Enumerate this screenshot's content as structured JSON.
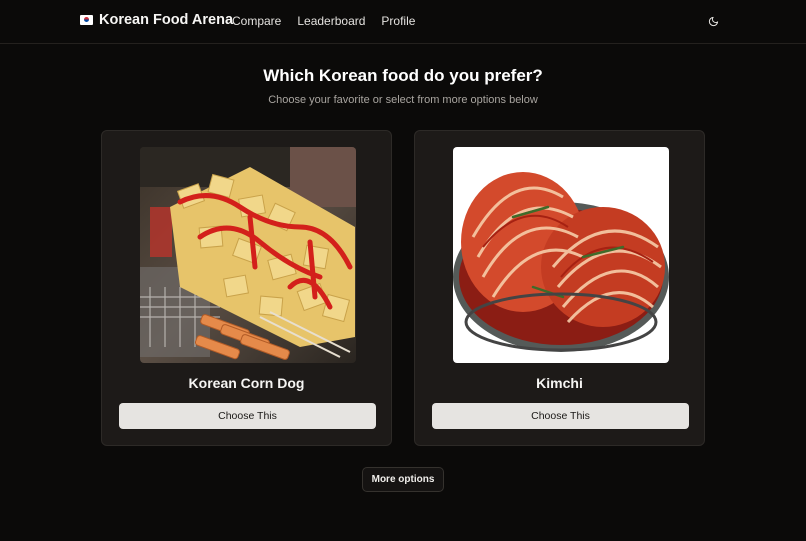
{
  "header": {
    "brand_title": "Korean Food Arena",
    "nav": [
      "Compare",
      "Leaderboard",
      "Profile"
    ],
    "theme_icon": "moon-icon"
  },
  "main": {
    "heading": "Which Korean food do you prefer?",
    "subheading": "Choose your favorite or select from more options below",
    "options": [
      {
        "name": "Korean Corn Dog",
        "button_label": "Choose This"
      },
      {
        "name": "Kimchi",
        "button_label": "Choose This"
      }
    ],
    "more_options_label": "More options"
  },
  "colors": {
    "background": "#0b0a09",
    "card": "#1d1a18",
    "button": "#e6e4e1"
  }
}
